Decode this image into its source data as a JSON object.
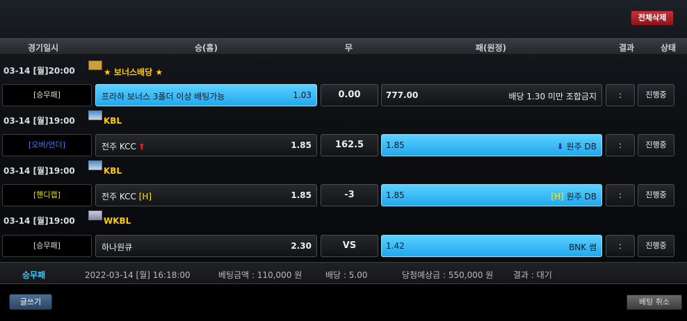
{
  "topbar": {
    "delete_all_label": "전체삭제"
  },
  "header": {
    "date": "경기일시",
    "home": "승(홈)",
    "draw": "무",
    "away": "패(원정)",
    "result": "결과",
    "status": "상태"
  },
  "games": [
    {
      "datetime": "03-14 [월]20:00",
      "league": "★ 보너스배당 ★",
      "league_icon": "bonus-icon",
      "type": "[승무패]",
      "home_name": "프라하 보너스 3폴더 이상 배팅가능",
      "home_odds": "1.03",
      "draw": "0.00",
      "away_odds": "777.00",
      "away_name": "배당 1.30 미만 조합금지",
      "result": ":",
      "status": "진행중"
    },
    {
      "datetime": "03-14 [월]19:00",
      "league": "KBL",
      "league_icon": "korea-flag-icon",
      "type": "[오버/언더]",
      "home_name": "전주 KCC",
      "home_odds": "1.85",
      "draw": "162.5",
      "away_odds": "1.85",
      "away_name": "원주 DB",
      "result": ":",
      "status": "진행중"
    },
    {
      "datetime": "03-14 [월]19:00",
      "league": "KBL",
      "league_icon": "korea-flag-icon",
      "type": "[핸디캡]",
      "home_name": "전주 KCC",
      "home_tag": "[H]",
      "home_odds": "1.85",
      "draw": "-3",
      "away_odds": "1.85",
      "away_tag": "[H]",
      "away_name": "원주 DB",
      "result": ":",
      "status": "진행중"
    },
    {
      "datetime": "03-14 [월]19:00",
      "league": "WKBL",
      "league_icon": "korea-flag-icon",
      "type": "[승무패]",
      "home_name": "하나원큐",
      "home_odds": "2.30",
      "draw": "VS",
      "away_odds": "1.42",
      "away_name": "BNK 썸",
      "result": ":",
      "status": "진행중"
    }
  ],
  "summary": {
    "type": "승무패",
    "datetime": "2022-03-14 [월] 16:18:00",
    "amount": "베팅금액 : 110,000 원",
    "odds": "배당 : 5.00",
    "expected": "당첨예상금 : 550,000 원",
    "result": "결과 : 대기"
  },
  "buttons": {
    "write": "글쓰기",
    "cancel": "베팅 취소"
  }
}
